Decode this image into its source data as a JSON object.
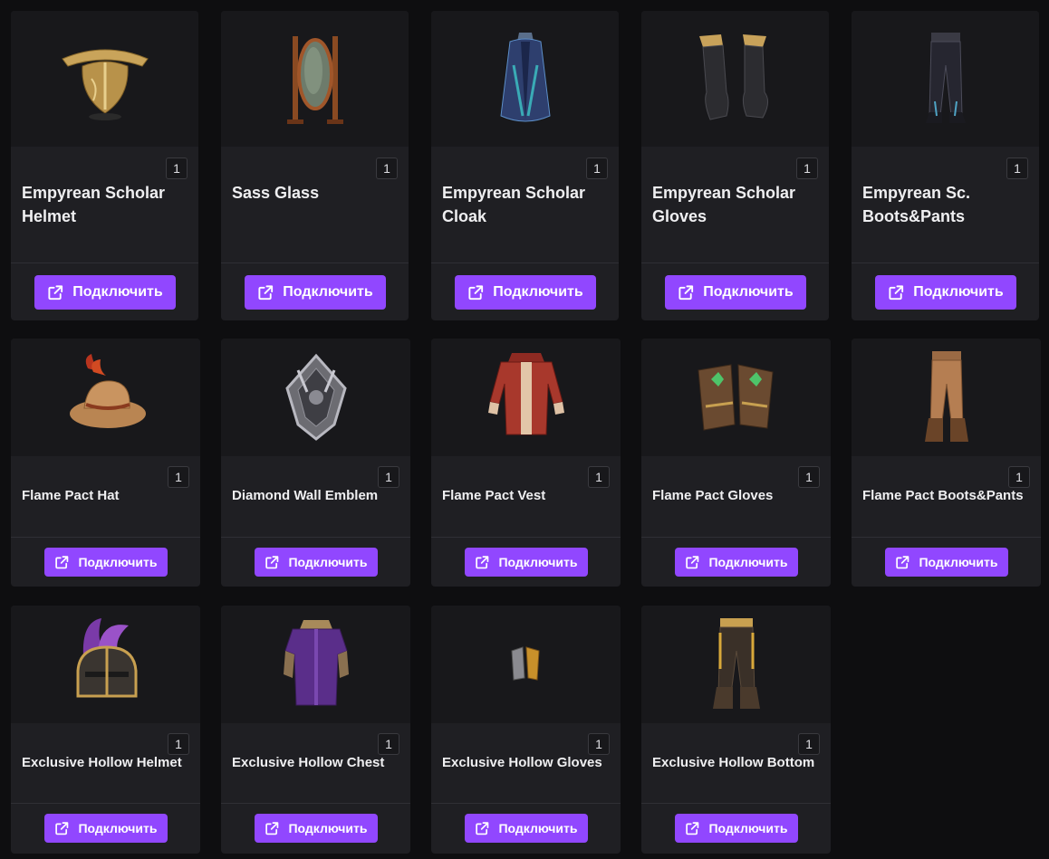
{
  "button_label": "Подключить",
  "colors": {
    "accent": "#9147ff",
    "card": "#1f1f23",
    "image_bg": "#18181b",
    "page_bg": "#0e0e10"
  },
  "items": [
    {
      "name": "Empyrean Scholar\nHelmet",
      "qty": "1",
      "icon": "gold-helmet-icon"
    },
    {
      "name": "Sass Glass",
      "qty": "1",
      "icon": "standing-mirror-icon"
    },
    {
      "name": "Empyrean Scholar\nCloak",
      "qty": "1",
      "icon": "blue-cloak-icon"
    },
    {
      "name": "Empyrean Scholar\nGloves",
      "qty": "1",
      "icon": "black-gloves-icon"
    },
    {
      "name": "Empyrean Sc.\nBoots&Pants",
      "qty": "1",
      "icon": "dark-pants-icon"
    },
    {
      "name": "Flame Pact Hat",
      "qty": "1",
      "icon": "feathered-hat-icon"
    },
    {
      "name": "Diamond Wall Emblem",
      "qty": "1",
      "icon": "silver-emblem-icon"
    },
    {
      "name": "Flame Pact Vest",
      "qty": "1",
      "icon": "red-vest-icon"
    },
    {
      "name": "Flame Pact Gloves",
      "qty": "1",
      "icon": "brown-gloves-icon"
    },
    {
      "name": "Flame Pact Boots&Pants",
      "qty": "1",
      "icon": "tan-pants-icon"
    },
    {
      "name": "Exclusive Hollow Helmet",
      "qty": "1",
      "icon": "plumed-helmet-icon"
    },
    {
      "name": "Exclusive Hollow Chest",
      "qty": "1",
      "icon": "purple-robe-icon"
    },
    {
      "name": "Exclusive Hollow Gloves",
      "qty": "1",
      "icon": "small-gloves-icon"
    },
    {
      "name": "Exclusive Hollow Bottom",
      "qty": "1",
      "icon": "dark-trousers-icon"
    }
  ]
}
